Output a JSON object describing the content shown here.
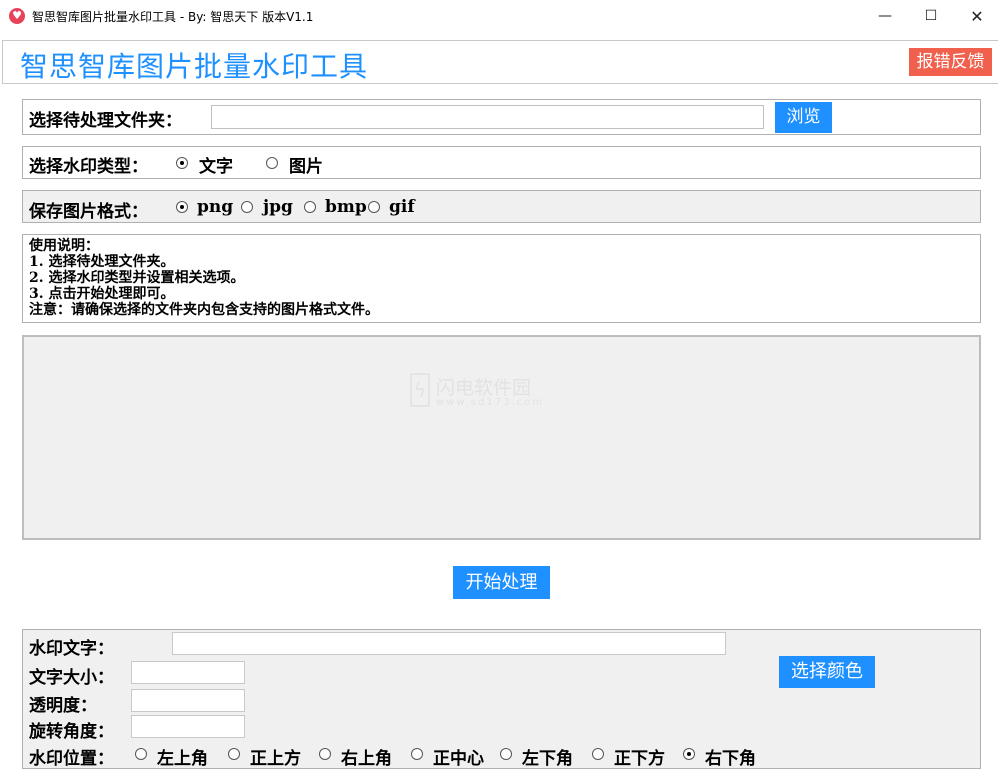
{
  "window": {
    "title": "智思智库图片批量水印工具 - By: 智思天下 版本V1.1",
    "app_icon": "heart-icon",
    "minimize_glyph": "—",
    "maximize_glyph": "☐",
    "close_glyph": "✕"
  },
  "header": {
    "title": "智思智库图片批量水印工具",
    "report_label": "报错反馈"
  },
  "folder": {
    "label": "选择待处理文件夹：",
    "value": "",
    "browse_label": "浏览"
  },
  "watermark_type": {
    "label": "选择水印类型：",
    "options": [
      {
        "label": "文字",
        "selected": true
      },
      {
        "label": "图片",
        "selected": false
      }
    ]
  },
  "save_format": {
    "label": "保存图片格式：",
    "options": [
      {
        "label": "png",
        "selected": true
      },
      {
        "label": "jpg",
        "selected": false
      },
      {
        "label": "bmp",
        "selected": false
      },
      {
        "label": "gif",
        "selected": false
      }
    ]
  },
  "instructions": {
    "lines": [
      "使用说明：",
      "1. 选择待处理文件夹。",
      "2. 选择水印类型并设置相关选项。",
      "3. 点击开始处理即可。",
      "注意：请确保选择的文件夹内包含支持的图片格式文件。"
    ]
  },
  "preview": {
    "watermark_text": "闪电软件园",
    "watermark_url": "www.sd173.com"
  },
  "actions": {
    "start_label": "开始处理"
  },
  "settings": {
    "text_label": "水印文字：",
    "text_value": "",
    "size_label": "文字大小：",
    "size_value": "",
    "opacity_label": "透明度：",
    "opacity_value": "",
    "rotation_label": "旋转角度：",
    "rotation_value": "",
    "color_label": "选择颜色",
    "position_label": "水印位置：",
    "positions": [
      {
        "label": "左上角",
        "selected": false
      },
      {
        "label": "正上方",
        "selected": false
      },
      {
        "label": "右上角",
        "selected": false
      },
      {
        "label": "正中心",
        "selected": false
      },
      {
        "label": "左下角",
        "selected": false
      },
      {
        "label": "正下方",
        "selected": false
      },
      {
        "label": "右下角",
        "selected": true
      }
    ]
  }
}
